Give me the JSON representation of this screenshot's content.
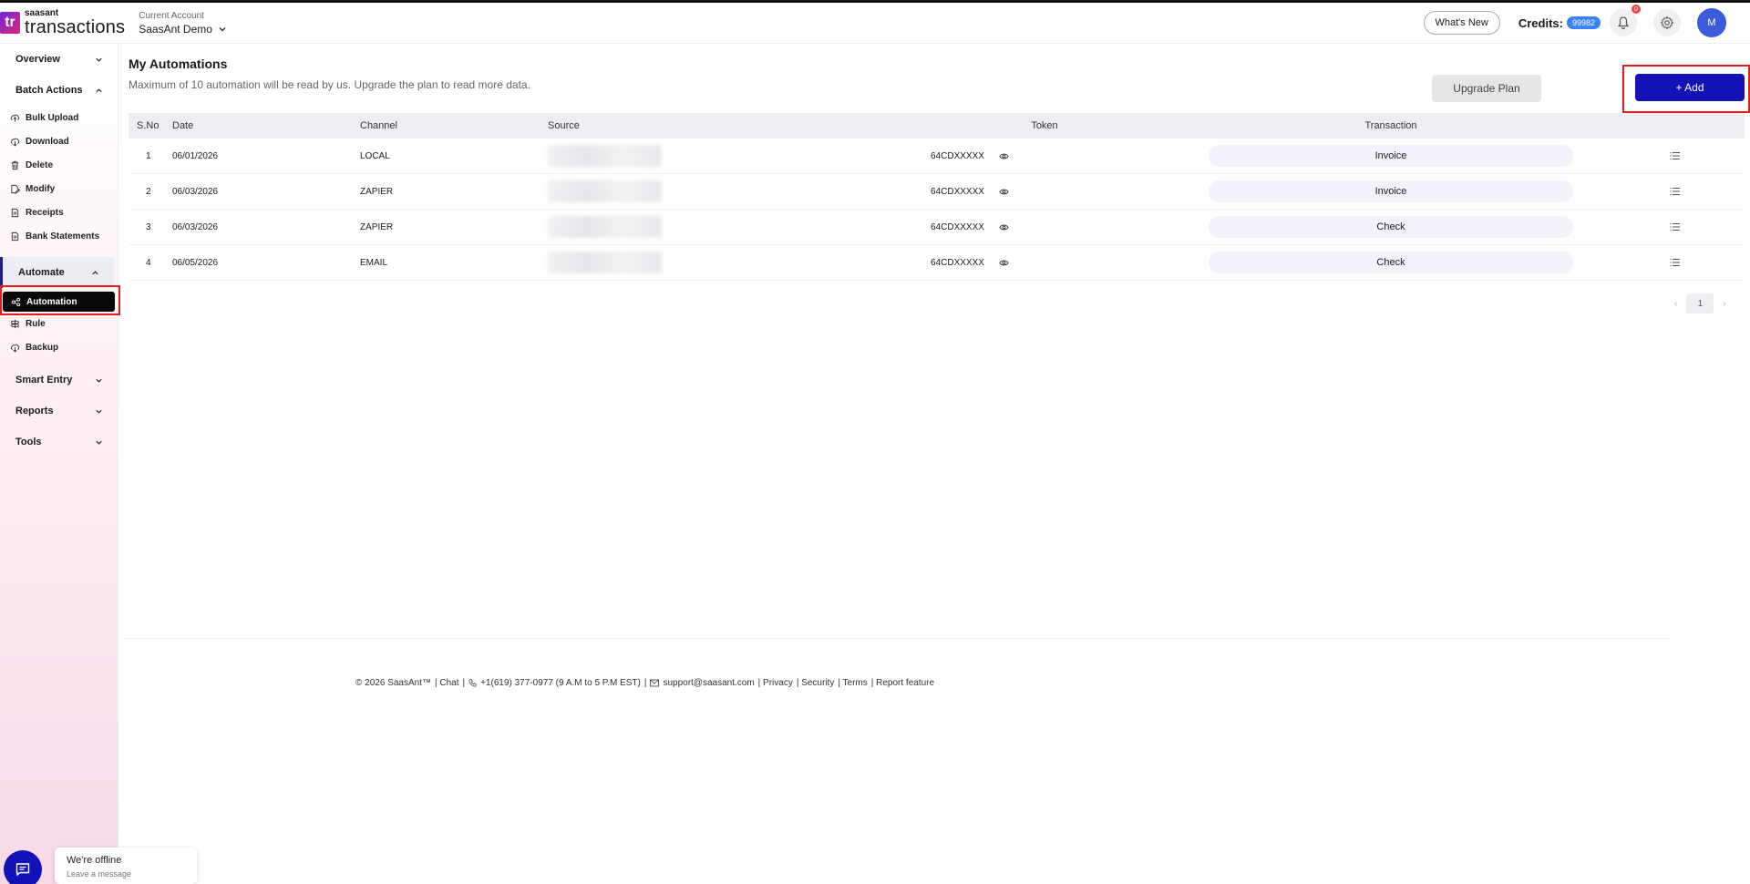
{
  "header": {
    "logo_small": "saasant",
    "logo_big": "transactions",
    "logo_mark": "tr",
    "account_label": "Current Account",
    "account_name": "SaasAnt Demo",
    "whats_new": "What's New",
    "credits_label": "Credits:",
    "credits_value": "99982",
    "notification_count": "0",
    "avatar_initial": "M"
  },
  "sidebar": {
    "overview": "Overview",
    "batch_actions": "Batch Actions",
    "batch_items": [
      "Bulk Upload",
      "Download",
      "Delete",
      "Modify",
      "Receipts",
      "Bank Statements"
    ],
    "automate": "Automate",
    "automate_items": [
      "Automation",
      "Rule",
      "Backup"
    ],
    "smart_entry": "Smart Entry",
    "reports": "Reports",
    "tools": "Tools"
  },
  "main": {
    "title": "My Automations",
    "subtitle": "Maximum of 10 automation will be read by us. Upgrade the plan to read more data.",
    "upgrade_label": "Upgrade Plan",
    "add_label": "+ Add"
  },
  "table": {
    "headers": [
      "S.No",
      "Date",
      "Channel",
      "Source",
      "Token",
      "Transaction"
    ],
    "rows": [
      {
        "sno": "1",
        "date": "06/01/2026",
        "channel": "LOCAL",
        "token": "64CDXXXXX",
        "transaction": "Invoice"
      },
      {
        "sno": "2",
        "date": "06/03/2026",
        "channel": "ZAPIER",
        "token": "64CDXXXXX",
        "transaction": "Invoice"
      },
      {
        "sno": "3",
        "date": "06/03/2026",
        "channel": "ZAPIER",
        "token": "64CDXXXXX",
        "transaction": "Check"
      },
      {
        "sno": "4",
        "date": "06/05/2026",
        "channel": "EMAIL",
        "token": "64CDXXXXX",
        "transaction": "Check"
      }
    ]
  },
  "pagination": {
    "current": "1"
  },
  "footer": {
    "copyright": "© 2026 SaasAnt™",
    "chat": "| Chat",
    "phone": "+1(619) 377-0977 (9 A.M to 5 P.M EST)",
    "email": "support@saasant.com",
    "privacy": "| Privacy",
    "security": "| Security",
    "terms": "| Terms",
    "report": "| Report feature"
  },
  "chat_widget": {
    "title": "We're offline",
    "subtitle": "Leave a message"
  },
  "colors": {
    "accent": "#1212b8",
    "highlight": "#e11d1d"
  }
}
